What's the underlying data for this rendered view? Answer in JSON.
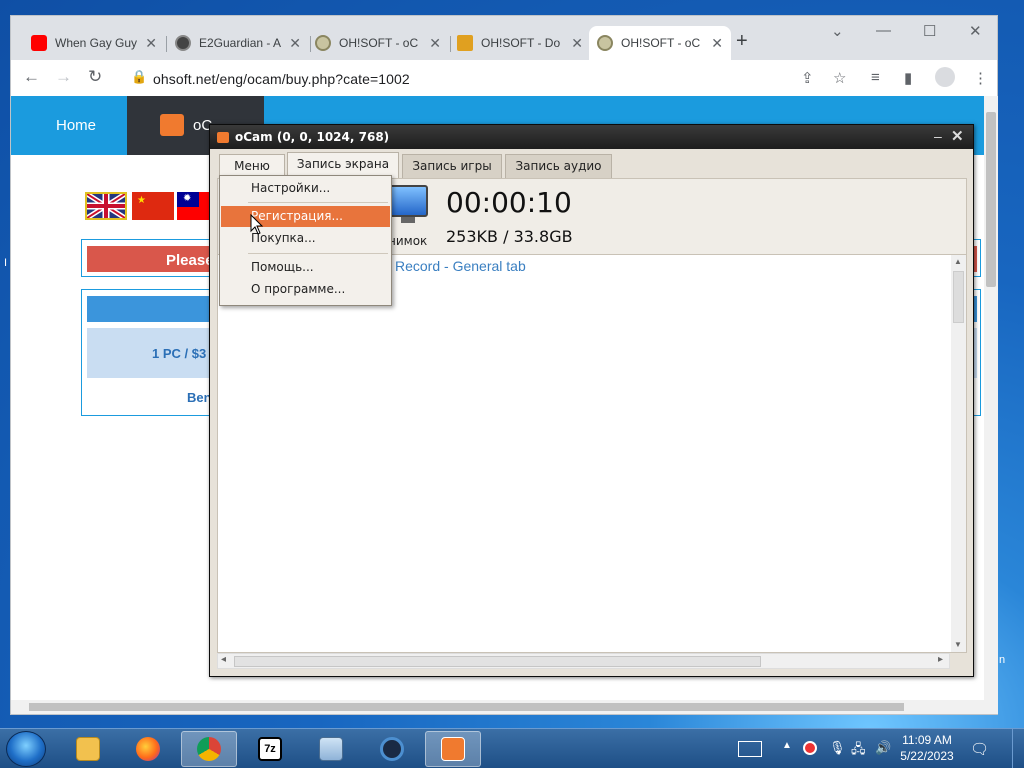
{
  "browser": {
    "tabs": [
      {
        "title": "When Gay Guy",
        "icon": "youtube-icon"
      },
      {
        "title": "E2Guardian - A",
        "icon": "globe-icon"
      },
      {
        "title": "OH!SOFT - oC",
        "icon": "ohsoft-icon"
      },
      {
        "title": "OH!SOFT - Do",
        "icon": "ohsoft-download-icon"
      },
      {
        "title": "OH!SOFT - oC",
        "icon": "ohsoft-icon"
      }
    ],
    "new_tab_label": "+",
    "url": "ohsoft.net/eng/ocam/buy.php?cate=1002"
  },
  "site": {
    "nav_home": "Home",
    "nav_current": "oC",
    "please_text": "Please",
    "price_text": "1 PC / $3",
    "benefit_text": "Ben"
  },
  "ocam": {
    "title": "oCam (0, 0, 1024, 768)",
    "tabs": [
      "Меню",
      "Запись экрана",
      "Запись игры",
      "Запись аудио"
    ],
    "selected_tab": "Запись экрана",
    "timer": "00:00:10",
    "size_info": "253KB / 33.8GB",
    "snapshot_label": "нимок",
    "view_link": "Record - General tab",
    "menu_items": [
      "Настройки...",
      "Регистрация...",
      "Покупка...",
      "Помощь...",
      "О программе..."
    ],
    "highlighted_item": "Регистрация..."
  },
  "desktop": {
    "edge_left": "I",
    "edge_right": "n"
  },
  "taskbar": {
    "apps": [
      "explorer",
      "firefox",
      "chrome",
      "7zip",
      "task-manager",
      "recorder",
      "ocam"
    ],
    "active_app": "chrome",
    "clock_time": "11:09 AM",
    "clock_date": "5/22/2023"
  },
  "colors": {
    "site_blue": "#1b9bde",
    "ocam_accent": "#e8743c",
    "please_red": "#d9574b"
  }
}
